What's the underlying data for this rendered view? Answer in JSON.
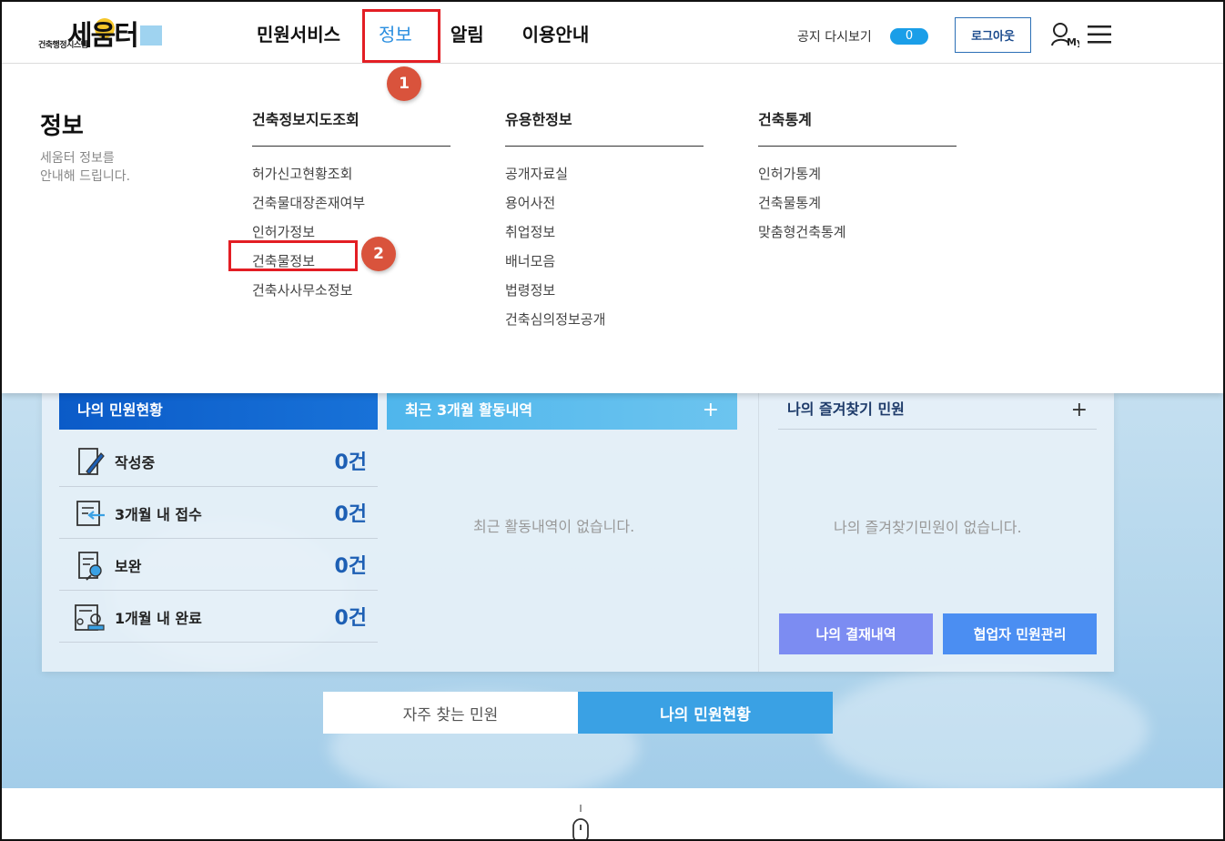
{
  "header": {
    "logo_text": "세움터",
    "logo_subtitle": "건축행정시스템",
    "nav": [
      {
        "label": "민원서비스"
      },
      {
        "label": "정보"
      },
      {
        "label": "알림"
      },
      {
        "label": "이용안내"
      }
    ],
    "notice_label": "공지 다시보기",
    "notice_count": "0",
    "logout_label": "로그아웃",
    "my_icon": "user-my-icon",
    "menu_icon": "hamburger-icon"
  },
  "annotations": {
    "step1": "1",
    "step2": "2",
    "highlight_color": "#e31e24",
    "badge_color": "#d9533c"
  },
  "dropdown": {
    "title": "정보",
    "desc_line1": "세움터 정보를",
    "desc_line2": "안내해 드립니다.",
    "columns": [
      {
        "heading": "건축정보지도조회",
        "links": [
          "허가신고현황조회",
          "건축물대장존재여부",
          "인허가정보",
          "건축물정보",
          "건축사사무소정보"
        ]
      },
      {
        "heading": "유용한정보",
        "links": [
          "공개자료실",
          "용어사전",
          "취업정보",
          "배너모음",
          "법령정보",
          "건축심의정보공개"
        ]
      },
      {
        "heading": "건축통계",
        "links": [
          "인허가통계",
          "건축물통계",
          "맞춤형건축통계"
        ]
      }
    ]
  },
  "my_status": {
    "title": "나의 민원현황",
    "rows": [
      {
        "label": "작성중",
        "count": "0건",
        "icon": "writing-icon"
      },
      {
        "label": "3개월 내 접수",
        "count": "0건",
        "icon": "receipt-icon"
      },
      {
        "label": "보완",
        "count": "0건",
        "icon": "supplement-icon"
      },
      {
        "label": "1개월 내 완료",
        "count": "0건",
        "icon": "complete-icon"
      }
    ]
  },
  "recent": {
    "title": "최근 3개월 활동내역",
    "plus": "+",
    "empty": "최근 활동내역이 없습니다."
  },
  "favorites": {
    "title": "나의 즐겨찾기 민원",
    "plus": "+",
    "empty": "나의 즐겨찾기민원이 없습니다.",
    "btn_payment": "나의 결재내역",
    "btn_partner": "협업자 민원관리"
  },
  "tabs": {
    "frequent": "자주 찾는 민원",
    "my_status": "나의 민원현황"
  },
  "colors": {
    "accent_blue": "#2b8fe0",
    "dark_blue": "#0b5bc8",
    "light_blue": "#4fb6ec",
    "btn_purple": "#7c8cf2",
    "btn_blue": "#4b8ef2"
  }
}
